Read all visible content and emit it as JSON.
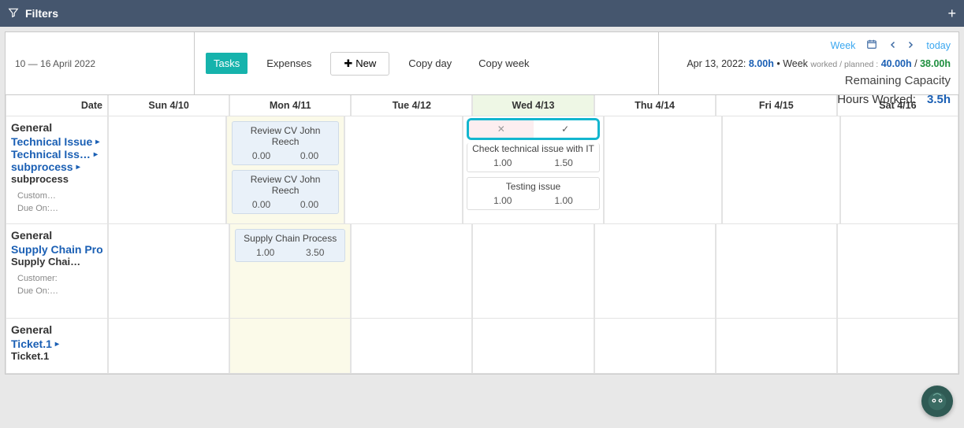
{
  "filters": {
    "title": "Filters"
  },
  "toolbar": {
    "date_range": "10 — 16 April 2022",
    "tasks": "Tasks",
    "expenses": "Expenses",
    "new": "New",
    "copy_day": "Copy day",
    "copy_week": "Copy week"
  },
  "nav": {
    "week": "Week",
    "today": "today"
  },
  "summary": {
    "date_label": "Apr 13, 2022:",
    "hours": "8.00h",
    "bullet": "•",
    "week_word": "Week",
    "wp": "worked / planned :",
    "h40": "40.00h",
    "slash": "/",
    "h38": "38.00h",
    "remaining": "Remaining Capacity",
    "hours_worked_label": "Hours Worked:",
    "hours_worked_value": "3.5h"
  },
  "columns": {
    "date": "Date",
    "days": [
      "Sun 4/10",
      "Mon 4/11",
      "Tue 4/12",
      "Wed 4/13",
      "Thu 4/14",
      "Fri 4/15",
      "Sat 4/16"
    ]
  },
  "rows": [
    {
      "group": "General",
      "links": [
        "Technical Issue",
        "Technical Iss…",
        "subprocess"
      ],
      "sub": "subprocess",
      "meta1": "Custom…",
      "meta2": "Due On:…",
      "mon": [
        {
          "title": "Review CV John Reech",
          "a": "0.00",
          "b": "0.00"
        },
        {
          "title": "Review CV John Reech",
          "a": "0.00",
          "b": "0.00"
        }
      ],
      "wed_edit": {
        "cancel": "✕",
        "ok": "✓"
      },
      "wed": [
        {
          "title": "Check technical issue with IT",
          "a": "1.00",
          "b": "1.50"
        },
        {
          "title": "Testing issue",
          "a": "1.00",
          "b": "1.00"
        }
      ]
    },
    {
      "group": "General",
      "links": [
        "Supply Chain Pro"
      ],
      "sub": "Supply Chai…",
      "meta1": "Customer:",
      "meta2": "Due On:…",
      "mon": [
        {
          "title": "Supply Chain Process",
          "a": "1.00",
          "b": "3.50"
        }
      ]
    },
    {
      "group": "General",
      "links": [
        "Ticket.1"
      ],
      "sub": "Ticket.1"
    }
  ]
}
